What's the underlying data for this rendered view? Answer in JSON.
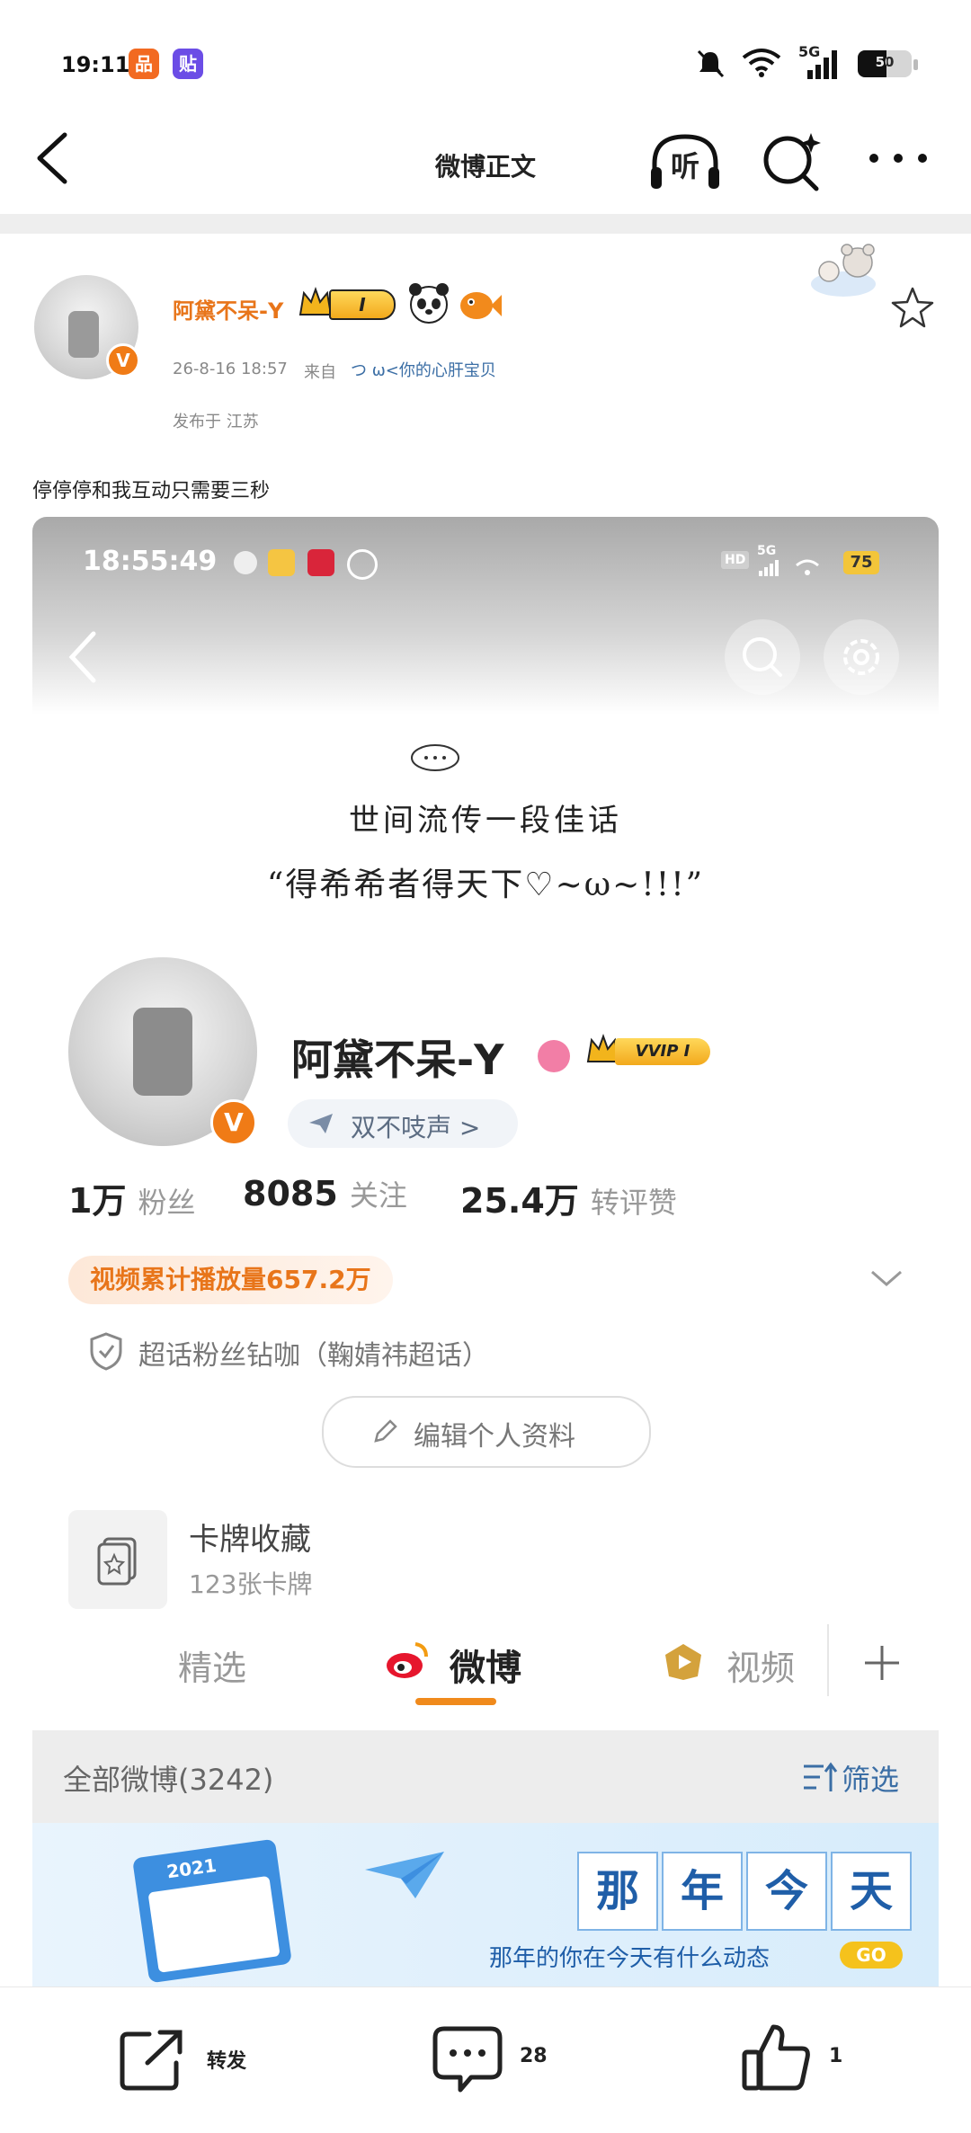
{
  "status_bar": {
    "time": "19:11",
    "app1_glyph": "品",
    "app2_glyph": "贴",
    "network": "5G",
    "battery": "50"
  },
  "nav": {
    "title": "微博正文",
    "listen_label": "听"
  },
  "post": {
    "username": "阿黛不呆-Y",
    "level_badge": "I",
    "time": "26-8-16 18:57",
    "from_label": "来自",
    "from_source": "つ ω<你的心肝宝贝",
    "location": "发布于 江苏",
    "text": "停停停和我互动只需要三秒"
  },
  "screenshot": {
    "status_time": "18:55:49",
    "battery": "75",
    "network": "5G",
    "hd": "HD",
    "bio_line1": "世间流传一段佳话",
    "bio_line2": "“得希希者得天下♡~ω~!!!”",
    "profile_name": "阿黛不呆-Y",
    "vvip_label": "VVIP I",
    "tag": "双不吱声 >",
    "stats": [
      {
        "num": "1万",
        "label": "粉丝"
      },
      {
        "num": "8085",
        "label": "关注"
      },
      {
        "num": "25.4万",
        "label": "转评赞"
      }
    ],
    "play_count": "视频累计播放量657.2万",
    "super_topic": "超话粉丝钻咖（鞠婧祎超话）",
    "edit_profile": "编辑个人资料",
    "card_title": "卡牌收藏",
    "card_sub": "123张卡牌",
    "tabs": [
      "精选",
      "微博",
      "视频"
    ],
    "all_weibo": "全部微博(3242)",
    "filter": "筛选",
    "banner_year": "2021",
    "banner_title": [
      "那",
      "年",
      "今",
      "天"
    ],
    "banner_sub": "那年的你在今天有什么动态",
    "banner_go": "GO"
  },
  "bottom_bar": {
    "forward": "转发",
    "comments": "28",
    "likes": "1"
  },
  "colors": {
    "accent": "#e8751a",
    "link": "#3b6ea5",
    "badge": "#f07b16"
  }
}
